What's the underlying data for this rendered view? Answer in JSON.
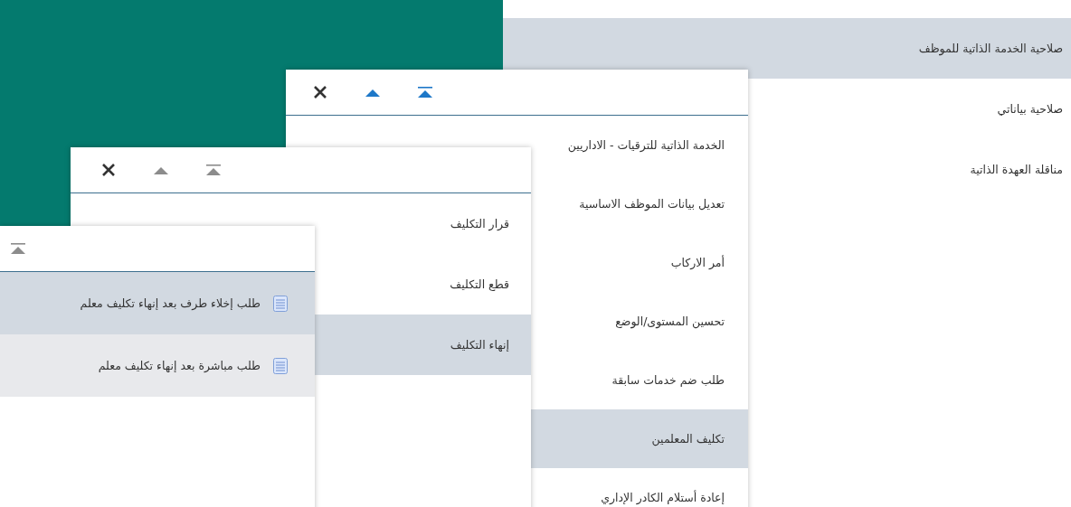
{
  "menu": {
    "items": [
      {
        "label": "صلاحية الخدمة الذاتية للموظف",
        "selected": true
      },
      {
        "label": "صلاحية بياناتي",
        "selected": false
      },
      {
        "label": "مناقلة العهدة الذاتية",
        "selected": false
      }
    ]
  },
  "panels": [
    {
      "active": true,
      "controls": [
        {
          "kind": "close"
        },
        {
          "kind": "up"
        },
        {
          "kind": "top"
        }
      ],
      "items": [
        {
          "kind": "folder",
          "label": "الخدمة الذاتية للترقيات - الاداريين",
          "selected": false,
          "hovered": false
        },
        {
          "kind": "folder",
          "label": "تعديل بيانات الموظف الاساسية",
          "selected": false,
          "hovered": false
        },
        {
          "kind": "folder",
          "label": "أمر الاركاب",
          "selected": false,
          "hovered": false
        },
        {
          "kind": "folder",
          "label": "تحسين المستوى/الوضع",
          "selected": false,
          "hovered": false
        },
        {
          "kind": "folder",
          "label": "طلب ضم خدمات سابقة",
          "selected": false,
          "hovered": false
        },
        {
          "kind": "folder",
          "label": "تكليف المعلمين",
          "selected": true,
          "hovered": false
        },
        {
          "kind": "folder",
          "label": "إعادة أستلام الكادر الإداري",
          "selected": false,
          "hovered": false
        }
      ]
    },
    {
      "active": false,
      "controls": [
        {
          "kind": "close"
        },
        {
          "kind": "up"
        },
        {
          "kind": "top"
        }
      ],
      "items": [
        {
          "kind": "folder",
          "label": "قرار التكليف",
          "selected": false,
          "hovered": false
        },
        {
          "kind": "folder",
          "label": "قطع التكليف",
          "selected": false,
          "hovered": false
        },
        {
          "kind": "folder",
          "label": "إنهاء التكليف",
          "selected": true,
          "hovered": false
        }
      ]
    },
    {
      "active": false,
      "controls": [
        {
          "kind": "top"
        }
      ],
      "items": [
        {
          "kind": "document",
          "label": "طلب إخلاء طرف بعد إنهاء تكليف معلم",
          "selected": true,
          "hovered": false
        },
        {
          "kind": "document",
          "label": "طلب مباشرة بعد إنهاء تكليف معلم",
          "selected": false,
          "hovered": true
        }
      ]
    }
  ]
}
